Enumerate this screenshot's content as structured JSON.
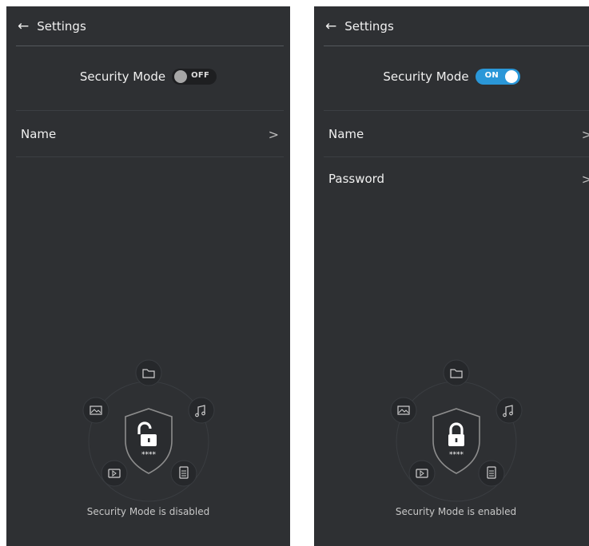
{
  "left": {
    "header": {
      "back_symbol": "←",
      "title": "Settings"
    },
    "security": {
      "label": "Security Mode",
      "toggle_text": "OFF"
    },
    "items": [
      {
        "label": "Name",
        "chevron": ">"
      }
    ],
    "status": "Security Mode is disabled",
    "lock_state": "unlocked-padlock-icon"
  },
  "right": {
    "header": {
      "back_symbol": "←",
      "title": "Settings"
    },
    "security": {
      "label": "Security Mode",
      "toggle_text": "ON"
    },
    "items": [
      {
        "label": "Name",
        "chevron": ">"
      },
      {
        "label": "Password",
        "chevron": ">"
      }
    ],
    "status": "Security Mode is enabled",
    "lock_state": "locked-padlock-icon"
  },
  "graphic": {
    "password_mask": "****",
    "icons": [
      "folder-icon",
      "image-icon",
      "music-icon",
      "video-icon",
      "document-icon"
    ]
  },
  "colors": {
    "background": "#2e3033",
    "toggle_on": "#2a97d8",
    "toggle_off": "#1e1f21"
  }
}
